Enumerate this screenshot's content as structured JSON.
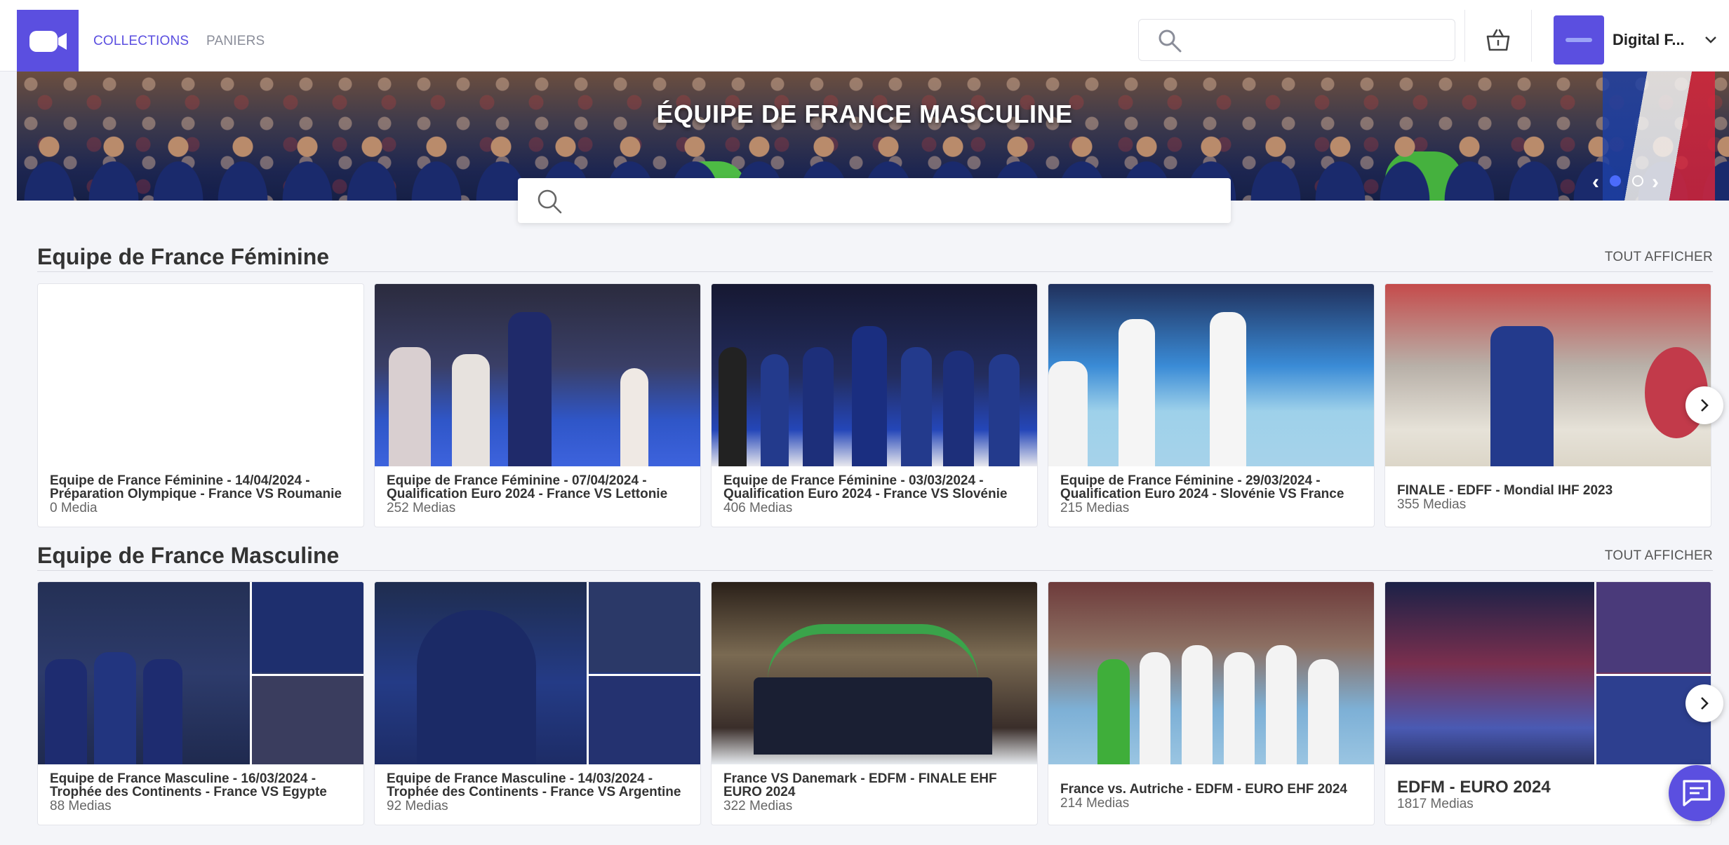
{
  "colors": {
    "accent": "#5b4fe0",
    "background": "#f4f5f9"
  },
  "header": {
    "logo_icon": "video-camera-icon",
    "nav": [
      {
        "label": "COLLECTIONS",
        "active": true
      },
      {
        "label": "PANIERS",
        "active": false
      }
    ],
    "search": {
      "placeholder": "",
      "value": ""
    },
    "cart_icon": "basket-icon",
    "user": {
      "name": "Digital F...",
      "chevron_icon": "chevron-down-icon"
    }
  },
  "hero": {
    "title": "ÉQUIPE DE FRANCE MASCULINE",
    "prev": "‹",
    "next": "›",
    "slides": 2,
    "active_slide": 1,
    "search": {
      "placeholder": "",
      "value": ""
    }
  },
  "sections": [
    {
      "title": "Equipe de France Féminine",
      "see_all": "TOUT AFFICHER",
      "cards": [
        {
          "title": "Equipe de France Féminine - 14/04/2024 - Préparation Olympique - France VS Roumanie",
          "count": "0 Media"
        },
        {
          "title": "Equipe de France Féminine - 07/04/2024 - Qualification Euro 2024 - France VS Lettonie",
          "count": "252 Medias"
        },
        {
          "title": "Equipe de France Féminine - 03/03/2024 - Qualification Euro 2024 - France VS Slovénie",
          "count": "406 Medias"
        },
        {
          "title": "Equipe de France Féminine - 29/03/2024 - Qualification Euro 2024 - Slovénie VS France",
          "count": "215 Medias"
        },
        {
          "title": "FINALE - EDFF - Mondial IHF 2023",
          "count": "355 Medias"
        }
      ]
    },
    {
      "title": "Equipe de France Masculine",
      "see_all": "TOUT AFFICHER",
      "cards": [
        {
          "title": "Equipe de France Masculine - 16/03/2024 - Trophée des Continents - France VS Egypte",
          "count": "88 Medias"
        },
        {
          "title": "Equipe de France Masculine - 14/03/2024 - Trophée des Continents - France VS Argentine",
          "count": "92 Medias"
        },
        {
          "title": "France VS Danemark - EDFM - FINALE EHF EURO 2024",
          "count": "322 Medias"
        },
        {
          "title": "France vs. Autriche - EDFM - EURO EHF 2024",
          "count": "214 Medias"
        },
        {
          "title": "EDFM - EURO 2024",
          "count": "1817 Medias"
        }
      ]
    }
  ],
  "chat_icon": "chat-icon"
}
